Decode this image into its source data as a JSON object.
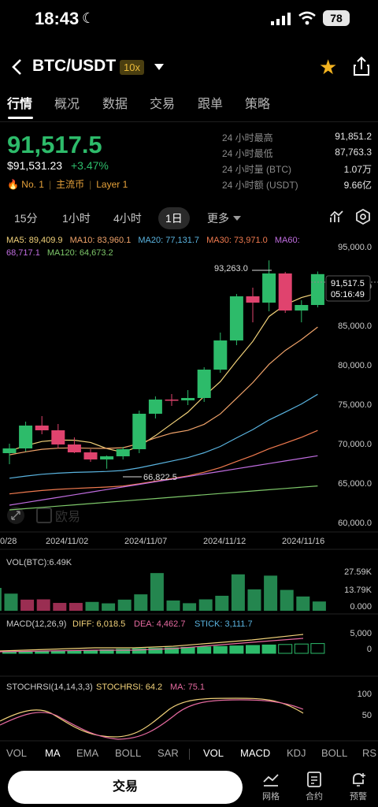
{
  "status": {
    "time": "18:43",
    "battery": "78"
  },
  "header": {
    "pair": "BTC/USDT",
    "leverage": "10x"
  },
  "tabs": [
    "行情",
    "概况",
    "数据",
    "交易",
    "跟单",
    "策略"
  ],
  "price": {
    "last": "91,517.5",
    "usd": "$91,531.23",
    "change": "+3.47%",
    "rank": "No. 1",
    "tag1": "主流币",
    "tag2": "Layer 1"
  },
  "stats": [
    {
      "k": "24 小时最高",
      "v": "91,851.2"
    },
    {
      "k": "24 小时最低",
      "v": "87,763.3"
    },
    {
      "k": "24 小时量 (BTC)",
      "v": "1.07万"
    },
    {
      "k": "24 小时额 (USDT)",
      "v": "9.66亿"
    }
  ],
  "intervals": {
    "i1": "15分",
    "i2": "1小时",
    "i3": "4小时",
    "i4": "1日",
    "more": "更多"
  },
  "ma": {
    "ma5": "MA5: 89,409.9",
    "ma10": "MA10: 83,960.1",
    "ma20": "MA20: 77,131.7",
    "ma30": "MA30: 73,971.0",
    "ma60": "MA60:",
    "ma60v": "68,717.1",
    "ma120": "MA120: 64,673.2"
  },
  "price_axis": [
    "95,000.0",
    "90,000.0",
    "85,000.0",
    "80,000.0",
    "75,000.0",
    "70,000.0",
    "65,000.0",
    "60,000.0"
  ],
  "date_axis": [
    "0/28",
    "2024/11/02",
    "2024/11/07",
    "2024/11/12",
    "2024/11/16"
  ],
  "annotations": {
    "high": "93,263.0",
    "low": "66,822.5",
    "current": "91,517.5",
    "countdown": "05:16:49",
    "watermark": "欧易"
  },
  "vol": {
    "label": "VOL(BTC):6.49K",
    "axis": [
      "27.59K",
      "13.79K",
      "0.000"
    ]
  },
  "macd": {
    "label": "MACD(12,26,9)",
    "diff": "DIFF: 6,018.5",
    "dea": "DEA: 4,462.7",
    "stick": "STICK: 3,111.7",
    "axis": [
      "5,000",
      "0"
    ]
  },
  "stoch": {
    "label": "STOCHRSI(14,14,3,3)",
    "value": "STOCHRSI: 64.2",
    "ma": "MA: 75.1",
    "axis": [
      "100",
      "50"
    ]
  },
  "indicator_bar": [
    "VOL",
    "MA",
    "EMA",
    "BOLL",
    "SAR",
    "VOL",
    "MACD",
    "KDJ",
    "BOLL",
    "RS"
  ],
  "bottom": {
    "trade": "交易",
    "grid": "网格",
    "contract": "合约",
    "alert": "预警"
  },
  "colors": {
    "up": "#2dbb6a",
    "down": "#e0436e",
    "ma5": "#f2d27a",
    "ma10": "#f0a36a",
    "ma20": "#5ab4e0",
    "ma30": "#f07a4f",
    "ma60": "#c06de0",
    "ma120": "#7ec86a"
  },
  "chart_data": {
    "type": "candlestick",
    "ohlc": [
      {
        "o": 68800,
        "h": 70000,
        "l": 67400,
        "c": 69400
      },
      {
        "o": 69400,
        "h": 72800,
        "l": 69000,
        "c": 72300
      },
      {
        "o": 72300,
        "h": 73500,
        "l": 71200,
        "c": 71700
      },
      {
        "o": 71700,
        "h": 72500,
        "l": 69400,
        "c": 69900
      },
      {
        "o": 69900,
        "h": 70800,
        "l": 68800,
        "c": 68900
      },
      {
        "o": 68900,
        "h": 69300,
        "l": 67700,
        "c": 68000
      },
      {
        "o": 68000,
        "h": 68500,
        "l": 66822.5,
        "c": 68400
      },
      {
        "o": 68400,
        "h": 69600,
        "l": 68000,
        "c": 69300
      },
      {
        "o": 69300,
        "h": 74200,
        "l": 68800,
        "c": 73800
      },
      {
        "o": 73800,
        "h": 76000,
        "l": 73200,
        "c": 75600
      },
      {
        "o": 75600,
        "h": 76300,
        "l": 74800,
        "c": 75500
      },
      {
        "o": 75500,
        "h": 76800,
        "l": 74900,
        "c": 75800
      },
      {
        "o": 75800,
        "h": 79700,
        "l": 75300,
        "c": 79400
      },
      {
        "o": 79400,
        "h": 84100,
        "l": 79000,
        "c": 83100
      },
      {
        "o": 83100,
        "h": 89000,
        "l": 82500,
        "c": 88700
      },
      {
        "o": 88700,
        "h": 89800,
        "l": 85400,
        "c": 87900
      },
      {
        "o": 87900,
        "h": 93263,
        "l": 86800,
        "c": 91600
      },
      {
        "o": 91600,
        "h": 91800,
        "l": 86600,
        "c": 86900
      },
      {
        "o": 86900,
        "h": 88200,
        "l": 85400,
        "c": 87600
      },
      {
        "o": 87600,
        "h": 91851,
        "l": 87300,
        "c": 91517.5
      }
    ],
    "volume": [
      16000,
      12000,
      7800,
      8000,
      5500,
      5500,
      6200,
      5200,
      7800,
      11500,
      26400,
      7200,
      5300,
      8000,
      10500,
      25500,
      15000,
      24600,
      14600,
      10000,
      6490
    ],
    "volume_up": [
      true,
      true,
      false,
      false,
      false,
      false,
      true,
      true,
      true,
      true,
      true,
      true,
      true,
      true,
      true,
      true,
      true,
      true,
      true,
      true,
      true
    ],
    "ylim": [
      60000,
      95000
    ]
  }
}
